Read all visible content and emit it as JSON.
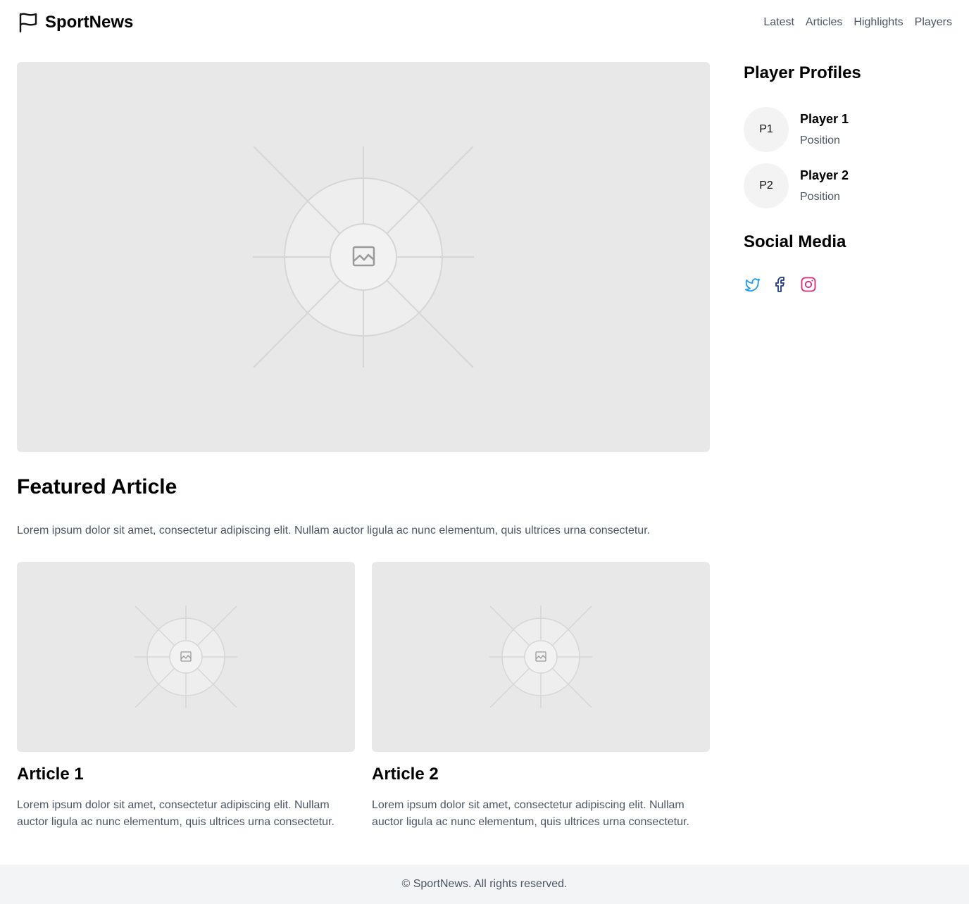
{
  "header": {
    "brand": "SportNews",
    "brand_icon": "flag-icon",
    "nav": [
      "Latest",
      "Articles",
      "Highlights",
      "Players"
    ]
  },
  "hero": {
    "image": "image-placeholder-icon"
  },
  "featured": {
    "title": "Featured Article",
    "text": "Lorem ipsum dolor sit amet, consectetur adipiscing elit. Nullam auctor ligula ac nunc elementum, quis ultrices urna consectetur."
  },
  "articles": [
    {
      "title": "Article 1",
      "text": "Lorem ipsum dolor sit amet, consectetur adipiscing elit. Nullam auctor ligula ac nunc elementum, quis ultrices urna consectetur."
    },
    {
      "title": "Article 2",
      "text": "Lorem ipsum dolor sit amet, consectetur adipiscing elit. Nullam auctor ligula ac nunc elementum, quis ultrices urna consectetur."
    }
  ],
  "sidebar": {
    "profiles_title": "Player Profiles",
    "players": [
      {
        "initials": "P1",
        "name": "Player 1",
        "position": "Position"
      },
      {
        "initials": "P2",
        "name": "Player 2",
        "position": "Position"
      }
    ],
    "social_title": "Social Media",
    "socials": [
      {
        "icon": "twitter-icon",
        "color": "#1d9bf0"
      },
      {
        "icon": "facebook-icon",
        "color": "#1e3a8a"
      },
      {
        "icon": "instagram-icon",
        "color": "#db2777"
      }
    ]
  },
  "footer": {
    "text": "© SportNews. All rights reserved."
  }
}
